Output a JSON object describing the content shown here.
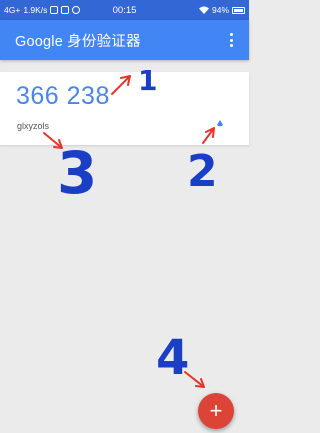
{
  "status_bar": {
    "network": "4G+",
    "speed": "1.9K/s",
    "time": "00:15",
    "battery": "94%"
  },
  "app_bar": {
    "title": "Google 身份验证器",
    "menu_icon": "more-vert-icon"
  },
  "entry": {
    "code": "366 238",
    "account": "glxyzols",
    "timer_color": "#4285f4"
  },
  "fab": {
    "label": "+",
    "icon": "add-icon",
    "color": "#db4437"
  },
  "annotations": {
    "label_1": "1",
    "label_2": "2",
    "label_3": "3",
    "label_4": "4",
    "ink_color": "#1a3fc4",
    "arrow_color": "#e8322c"
  },
  "colors": {
    "status_bar": "#3367d6",
    "app_bar": "#4285f4",
    "code_text": "#4a86e8",
    "background": "#ebebeb"
  }
}
